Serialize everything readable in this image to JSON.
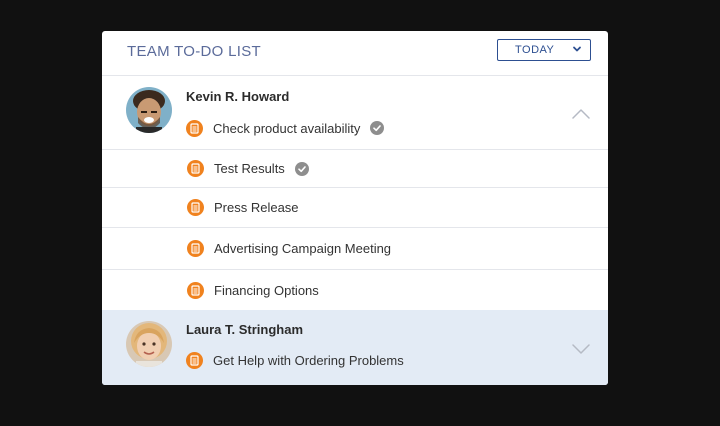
{
  "header": {
    "title": "TEAM TO-DO LIST",
    "filter": {
      "selected": "TODAY"
    }
  },
  "people": [
    {
      "name": "Kevin R. Howard",
      "expanded": true,
      "first_task": {
        "label": "Check product availability",
        "done": true
      }
    },
    {
      "name": "Laura T. Stringham",
      "expanded": false,
      "first_task": {
        "label": "Get Help with Ordering Problems",
        "done": false
      }
    }
  ],
  "tasks": [
    {
      "label": "Test Results",
      "done": true
    },
    {
      "label": "Press Release",
      "done": false
    },
    {
      "label": "Advertising Campaign Meeting",
      "done": false
    },
    {
      "label": "Financing Options",
      "done": false
    }
  ],
  "colors": {
    "task_icon": "#f0821e",
    "check": "#8e8e8e",
    "title": "#5b6b9a",
    "accent": "#2d4f91",
    "selected_row": "#e3ebf5"
  },
  "icons": {
    "task": "clipboard-icon",
    "done": "check-circle-icon",
    "expand": "chevron-down-icon",
    "collapse": "chevron-up-icon"
  }
}
